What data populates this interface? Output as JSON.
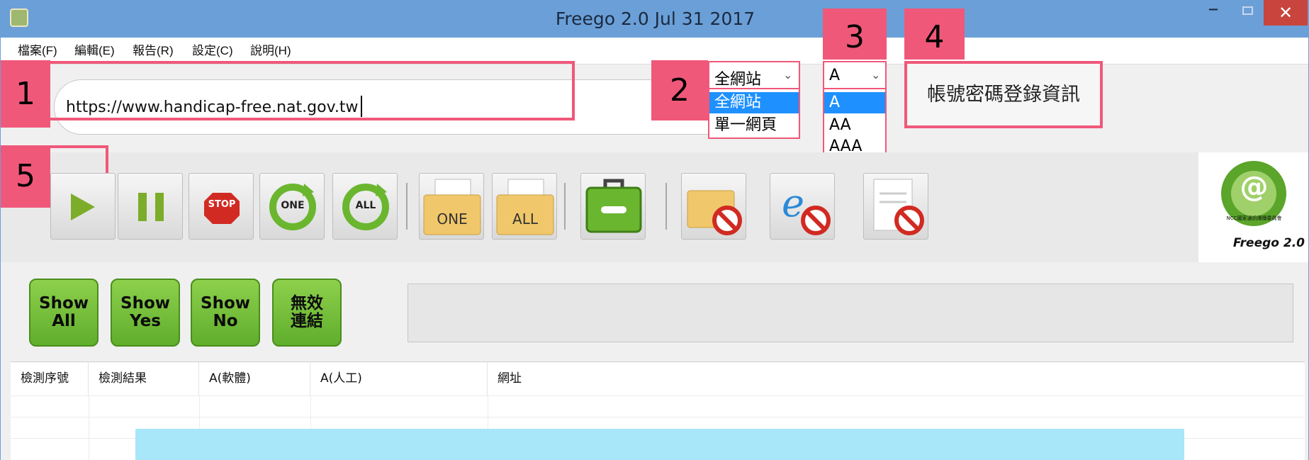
{
  "window": {
    "title": "Freego 2.0 Jul 31 2017",
    "minimize": "–",
    "close": "✕"
  },
  "menu": [
    "檔案(F)",
    "編輯(E)",
    "報告(R)",
    "設定(C)",
    "說明(H)"
  ],
  "callouts": [
    "1",
    "2",
    "3",
    "4",
    "5"
  ],
  "url": {
    "value": "https://www.handicap-free.nat.gov.tw"
  },
  "scope_select": {
    "selected": "全網站",
    "options": [
      "全網站",
      "單一網頁"
    ]
  },
  "level_select": {
    "selected": "A",
    "options": [
      "A",
      "AA",
      "AAA"
    ]
  },
  "login_button": "帳號密碼登錄資訊",
  "toolbar": {
    "stop_text": "STOP",
    "one_text": "ONE",
    "all_text": "ALL",
    "folder_one": "ONE",
    "folder_all": "ALL"
  },
  "filter_buttons": {
    "show_all": [
      "Show",
      "All"
    ],
    "show_yes": [
      "Show",
      "Yes"
    ],
    "show_no": [
      "Show",
      "No"
    ],
    "invalid": [
      "無效",
      "連結"
    ]
  },
  "table": {
    "headers": [
      "檢測序號",
      "檢測結果",
      "A(軟體)",
      "A(人工)",
      "網址"
    ]
  },
  "logo": {
    "name": "Freego 2.0",
    "ring_text": "NCC國家通訊傳播委員會"
  },
  "colors": {
    "titlebar": "#6b9fd7",
    "callout": "#f0587a",
    "green_button": "#7cc23e",
    "tip": "#a8e6fa",
    "selected": "#1e90ff"
  }
}
